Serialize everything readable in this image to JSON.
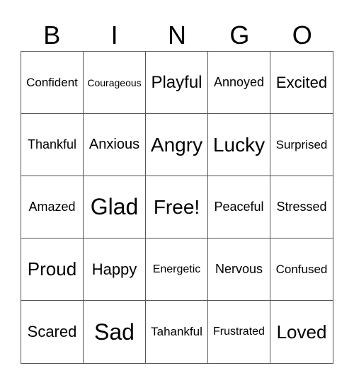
{
  "header": [
    "B",
    "I",
    "N",
    "G",
    "O"
  ],
  "cells": [
    "Confident",
    "Courageous",
    "Playful",
    "Annoyed",
    "Excited",
    "Thankful",
    "Anxious",
    "Angry",
    "Lucky",
    "Surprised",
    "Amazed",
    "Glad",
    "Free!",
    "Peaceful",
    "Stressed",
    "Proud",
    "Happy",
    "Energetic",
    "Nervous",
    "Confused",
    "Scared",
    "Sad",
    "Tahankful",
    "Frustrated",
    "Loved"
  ]
}
